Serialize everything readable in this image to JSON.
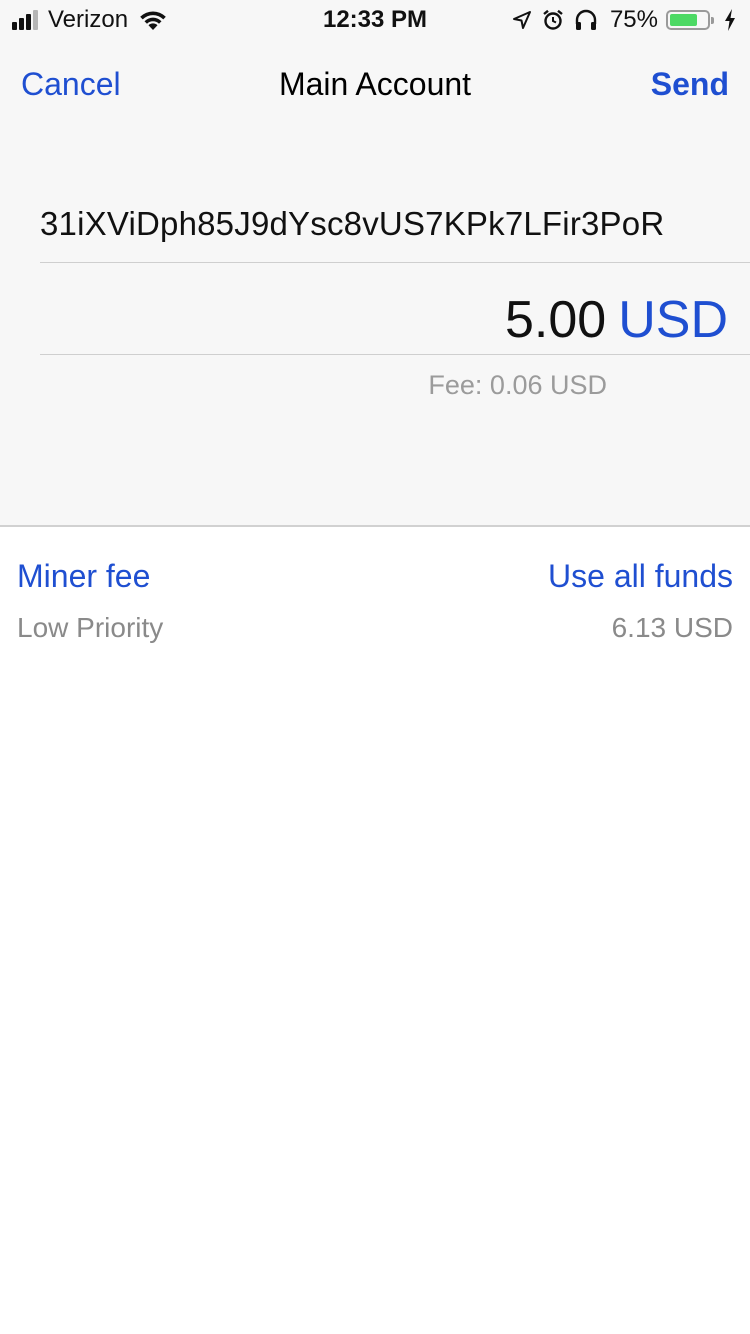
{
  "status_bar": {
    "carrier": "Verizon",
    "time": "12:33 PM",
    "battery_percent": "75%",
    "battery_level": 0.75,
    "signal_bars": 4,
    "signal_active": 3,
    "icons": [
      "wifi-icon",
      "location-arrow-icon",
      "alarm-icon",
      "headphones-icon",
      "battery-icon",
      "charging-bolt-icon"
    ]
  },
  "nav": {
    "cancel_label": "Cancel",
    "title": "Main Account",
    "send_label": "Send"
  },
  "form": {
    "address": "31iXViDph85J9dYsc8vUS7KPk7LFir3PoR",
    "amount": "5.00",
    "currency": "USD",
    "fee": "Fee: 0.06 USD"
  },
  "options": {
    "miner_fee_label": "Miner fee",
    "priority": "Low Priority",
    "use_all_label": "Use all funds",
    "balance": "6.13 USD"
  },
  "colors": {
    "accent": "#1f4fd1",
    "secondary_text": "#8a8a8a",
    "battery_green": "#4cd964",
    "top_background": "#f7f7f7"
  }
}
